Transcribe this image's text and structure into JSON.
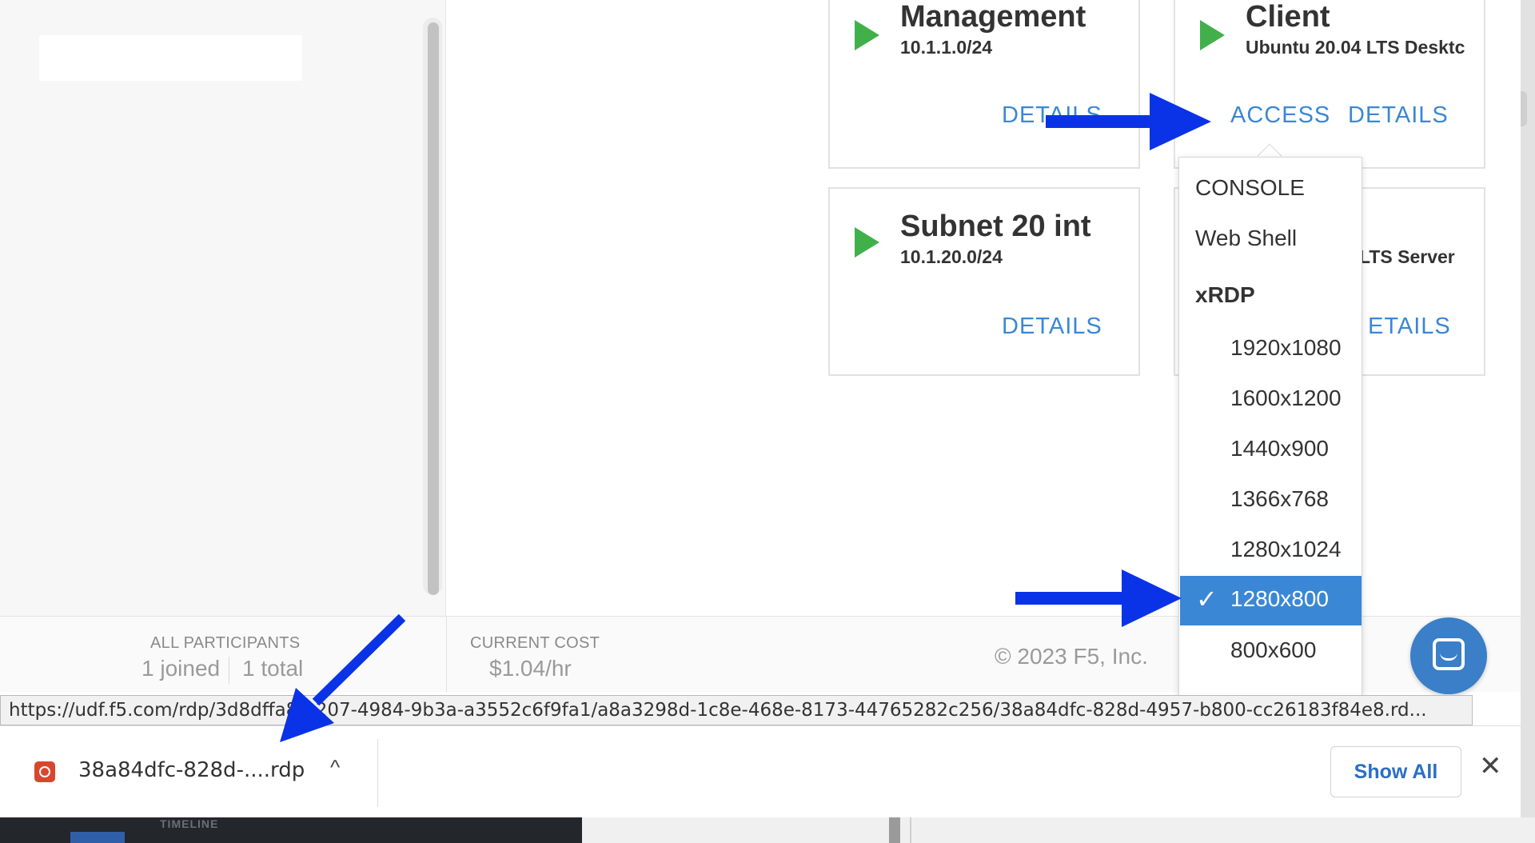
{
  "colors": {
    "accent_blue": "#3a87d6",
    "play_green": "#41b04b",
    "annotation_arrow": "#0a33e8",
    "rdp_icon": "#d9462e"
  },
  "cards": [
    {
      "title": "Management",
      "subtitle": "10.1.1.0/24",
      "details": "DETAILS"
    },
    {
      "title": "Client",
      "subtitle": "Ubuntu 20.04 LTS Desktc",
      "access": "ACCESS",
      "details": "DETAILS"
    },
    {
      "title": "Subnet 20 int",
      "subtitle": "10.1.20.0/24",
      "details": "DETAILS"
    },
    {
      "subtitle": "LTS Server",
      "details": "ETAILS"
    }
  ],
  "dropdown": {
    "items": [
      "CONSOLE",
      "Web Shell"
    ],
    "group_label": "xRDP",
    "resolutions": [
      "1920x1080",
      "1600x1200",
      "1440x900",
      "1366x768",
      "1280x1024",
      "1280x800",
      "800x600"
    ],
    "selected": "1280x800",
    "check_icon": "check-icon"
  },
  "footer": {
    "participants_label": "ALL PARTICIPANTS",
    "joined": "1 joined",
    "total": "1 total",
    "cost_label": "CURRENT COST",
    "cost_value": "$1.04/hr",
    "copyright": "© 2023 F5, Inc."
  },
  "status_url": "https://udf.f5.com/rdp/3d8dffa8-a207-4984-9b3a-a3552c6f9fa1/a8a3298d-1c8e-468e-8173-44765282c256/38a84dfc-828d-4957-b800-cc26183f84e8.rd...",
  "download": {
    "filename": "38a84dfc-828d-....rdp",
    "show_all": "Show All"
  },
  "background_app": {
    "timeline_label": "TIMELINE"
  }
}
